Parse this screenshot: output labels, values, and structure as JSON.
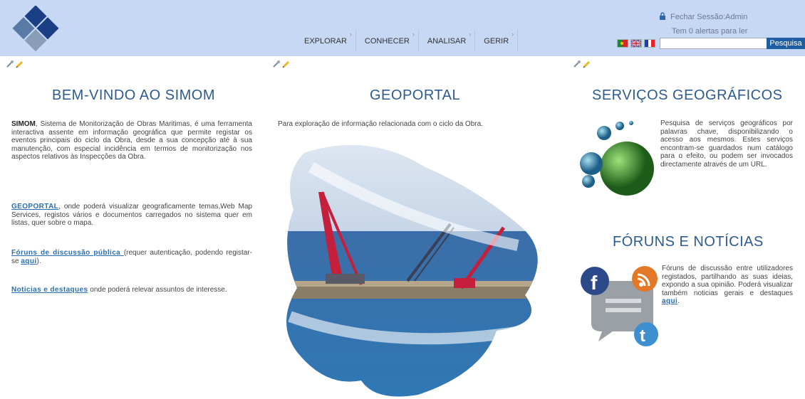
{
  "header": {
    "nav": [
      "EXPLORAR",
      "CONHECER",
      "ANALISAR",
      "GERIR"
    ],
    "session_text": "Fechar Sessão:Admin",
    "alerts_text": "Tem 0 alertas para ler",
    "search_placeholder": "",
    "search_button": "Pesquisa"
  },
  "left": {
    "title": "BEM-VINDO AO SIMOM",
    "intro_bold": "SIMOM",
    "intro_text": ", Sistema de Monitorização de Obras Maritimas, é uma ferramenta interactiva assente em informação geográfica que permite registar os eventos principais do ciclo da Obra, desde a sua concepção até à sua manutenção, com especial incidência em termos de monitorização nos aspectos relativos às Inspecções da Obra.",
    "geoportal_link": "GEOPORTAL",
    "geoportal_text": ", onde poderá visualizar geograficamente temas,Web Map Services, registos vários e documentos carregados no sistema quer em listas, quer sobre o mapa.",
    "forums_link": "Fóruns de discussão pública ",
    "forums_text": "(requer autenticação, podendo registar-se ",
    "forums_aqui": "aqui",
    "forums_end": ").",
    "news_link": "Noticias e destaques",
    "news_text": " onde poderá relevar assuntos de interesse."
  },
  "middle": {
    "title": "GEOPORTAL",
    "text": "Para exploração de informação relacionada com o ciclo da Obra."
  },
  "right": {
    "services_title": "SERVIÇOS GEOGRÁFICOS",
    "services_text": "Pesquisa de serviços geográficos por palavras chave, disponibilizando o acesso aos mesmos. Estes serviços encontram-se guardados num catálogo para o efeito, ou podem ser invocados directamente através de um URL.",
    "forums_title": "FÓRUNS E NOTÍCIAS",
    "forums_text": "Fóruns de discussão entre utilizadores registados, partilhando as suas ideias, expondo a sua opinião. Poderá visualizar também noticias gerais e destaques ",
    "forums_aqui": "aqui",
    "forums_end": "."
  },
  "colors": {
    "header_bg": "#c6d8f4",
    "title": "#2d5b8f",
    "link": "#2a6fb4",
    "search_button": "#1f5da3"
  }
}
